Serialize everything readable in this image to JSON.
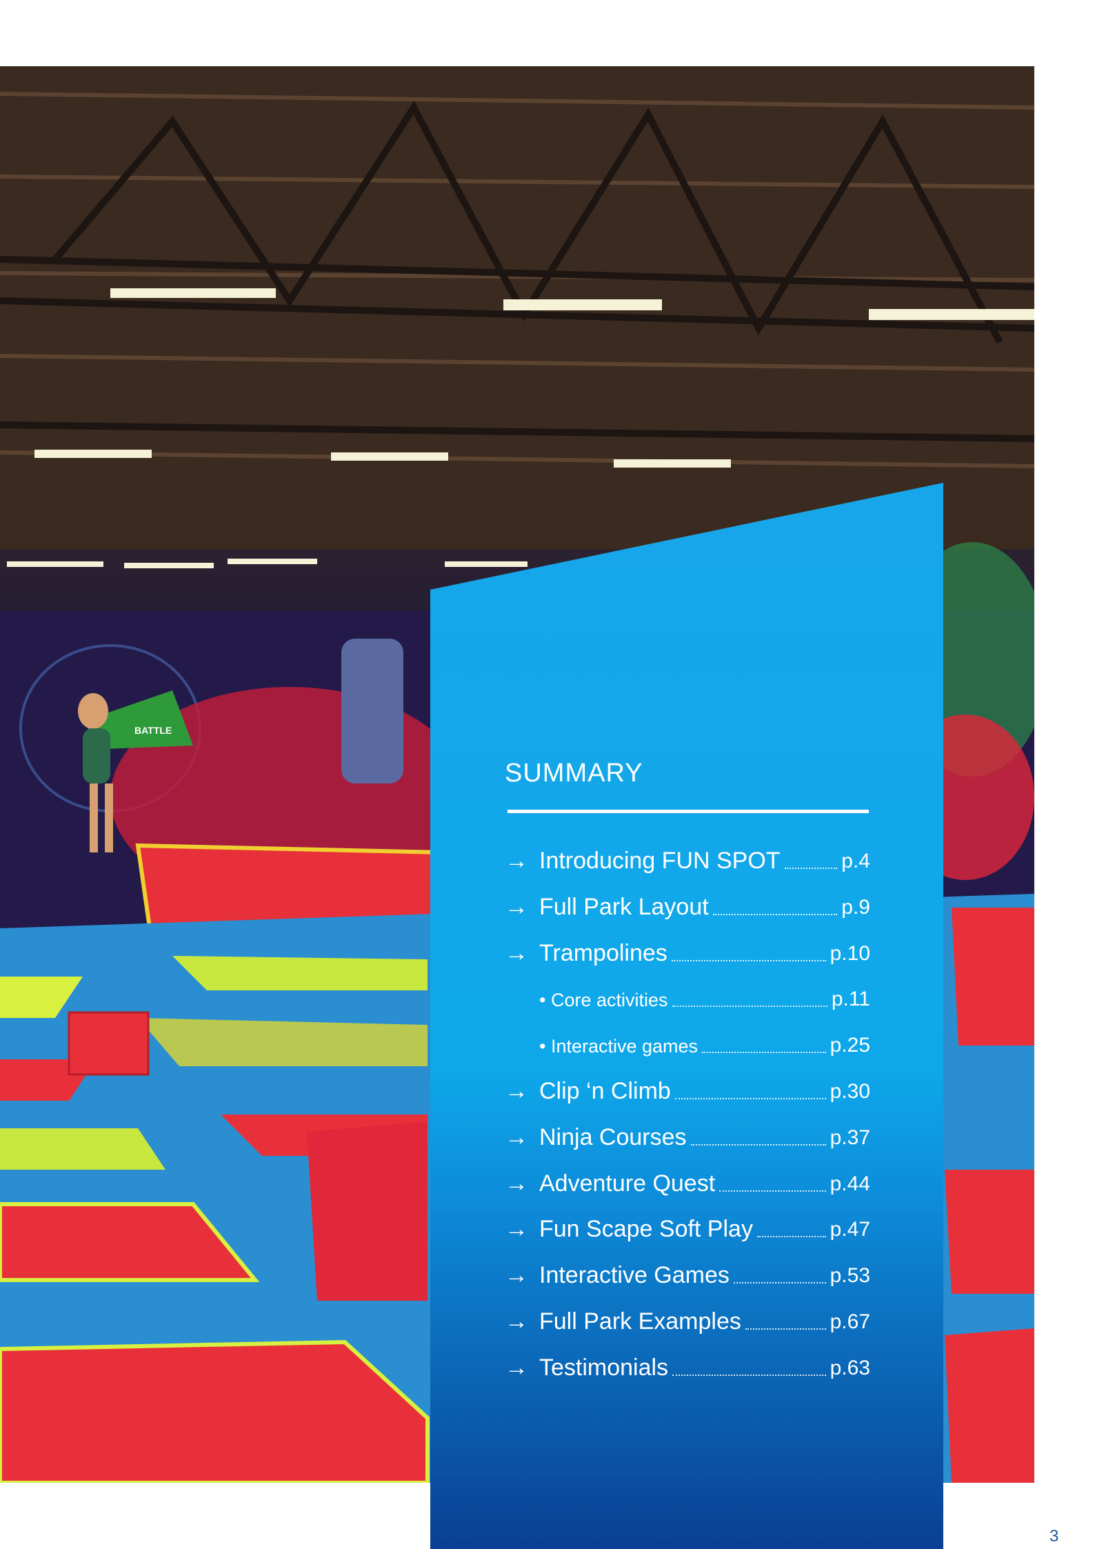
{
  "summary": {
    "title": "SUMMARY",
    "items": [
      {
        "arrow": "→",
        "label": "Introducing FUN SPOT",
        "page": "p.4",
        "sub": false
      },
      {
        "arrow": "→",
        "label": "Full Park Layout",
        "page": "p.9",
        "sub": false
      },
      {
        "arrow": "→",
        "label": "Trampolines",
        "page": "p.10",
        "sub": false
      },
      {
        "arrow": "",
        "label": "• Core activities",
        "page": "p.11",
        "sub": true
      },
      {
        "arrow": "",
        "label": "• Interactive games",
        "page": "p.25",
        "sub": true
      },
      {
        "arrow": "→",
        "label": "Clip ‘n Climb",
        "page": "p.30",
        "sub": false
      },
      {
        "arrow": "→",
        "label": "Ninja Courses",
        "page": "p.37",
        "sub": false
      },
      {
        "arrow": "→",
        "label": "Adventure Quest",
        "page": "p.44",
        "sub": false
      },
      {
        "arrow": "→",
        "label": "Fun Scape Soft Play",
        "page": "p.47",
        "sub": false
      },
      {
        "arrow": "→",
        "label": "Interactive Games",
        "page": "p.53",
        "sub": false
      },
      {
        "arrow": "→",
        "label": "Full Park Examples",
        "page": "p.67",
        "sub": false
      },
      {
        "arrow": "→",
        "label": "Testimonials",
        "page": "p.63",
        "sub": false
      }
    ]
  },
  "photo": {
    "sign_text": "BATTLE"
  },
  "page_number": "3",
  "colors": {
    "panel_top": "#16a5ea",
    "panel_bottom": "#0a3f92",
    "page_number": "#1e5a96"
  }
}
